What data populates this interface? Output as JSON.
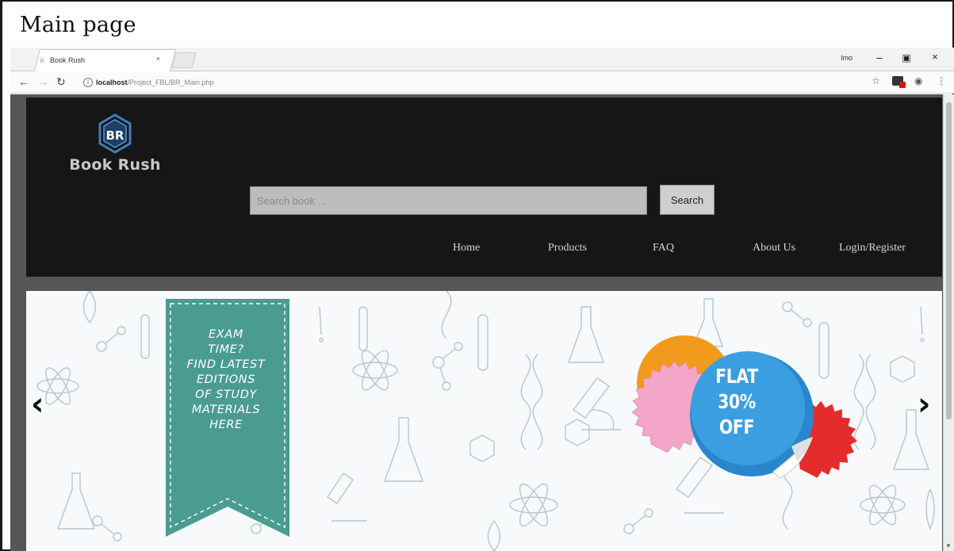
{
  "figure": {
    "caption": "Main page"
  },
  "browser": {
    "tab_title": "Book Rush",
    "tab_close": "×",
    "profile": "lmo",
    "url_host": "localhost",
    "url_path": "/Project_FBL/BR_Main.php",
    "icons": [
      "back-icon",
      "forward-icon",
      "reload-icon",
      "info-icon",
      "star-icon",
      "extension-icon",
      "settings-icon",
      "menu-icon"
    ]
  },
  "site": {
    "logo_text": "Book Rush",
    "logo_monogram": "BR",
    "search": {
      "placeholder": "Search book ...",
      "button_label": "Search"
    },
    "nav": [
      {
        "label": "Home"
      },
      {
        "label": "Products"
      },
      {
        "label": "FAQ"
      },
      {
        "label": "About Us"
      },
      {
        "label": "Login/Register"
      }
    ]
  },
  "banner": {
    "ribbon_lines": [
      "EXAM",
      "TIME?",
      "FIND LATEST",
      "EDITIONS",
      "OF STUDY",
      "MATERIALS",
      "HERE"
    ],
    "badge_lines": [
      "FLAT",
      "30% OFF"
    ],
    "prev_label": "‹",
    "next_label": "›",
    "colors": {
      "ribbon": "#4a9c90",
      "badge_blue": "#2a86cc",
      "badge_orange": "#f29a1e",
      "badge_red": "#e52b2b",
      "badge_pink": "#f3a6c8"
    }
  },
  "colors": {
    "header_bg": "#161616",
    "page_bg": "#565656"
  }
}
